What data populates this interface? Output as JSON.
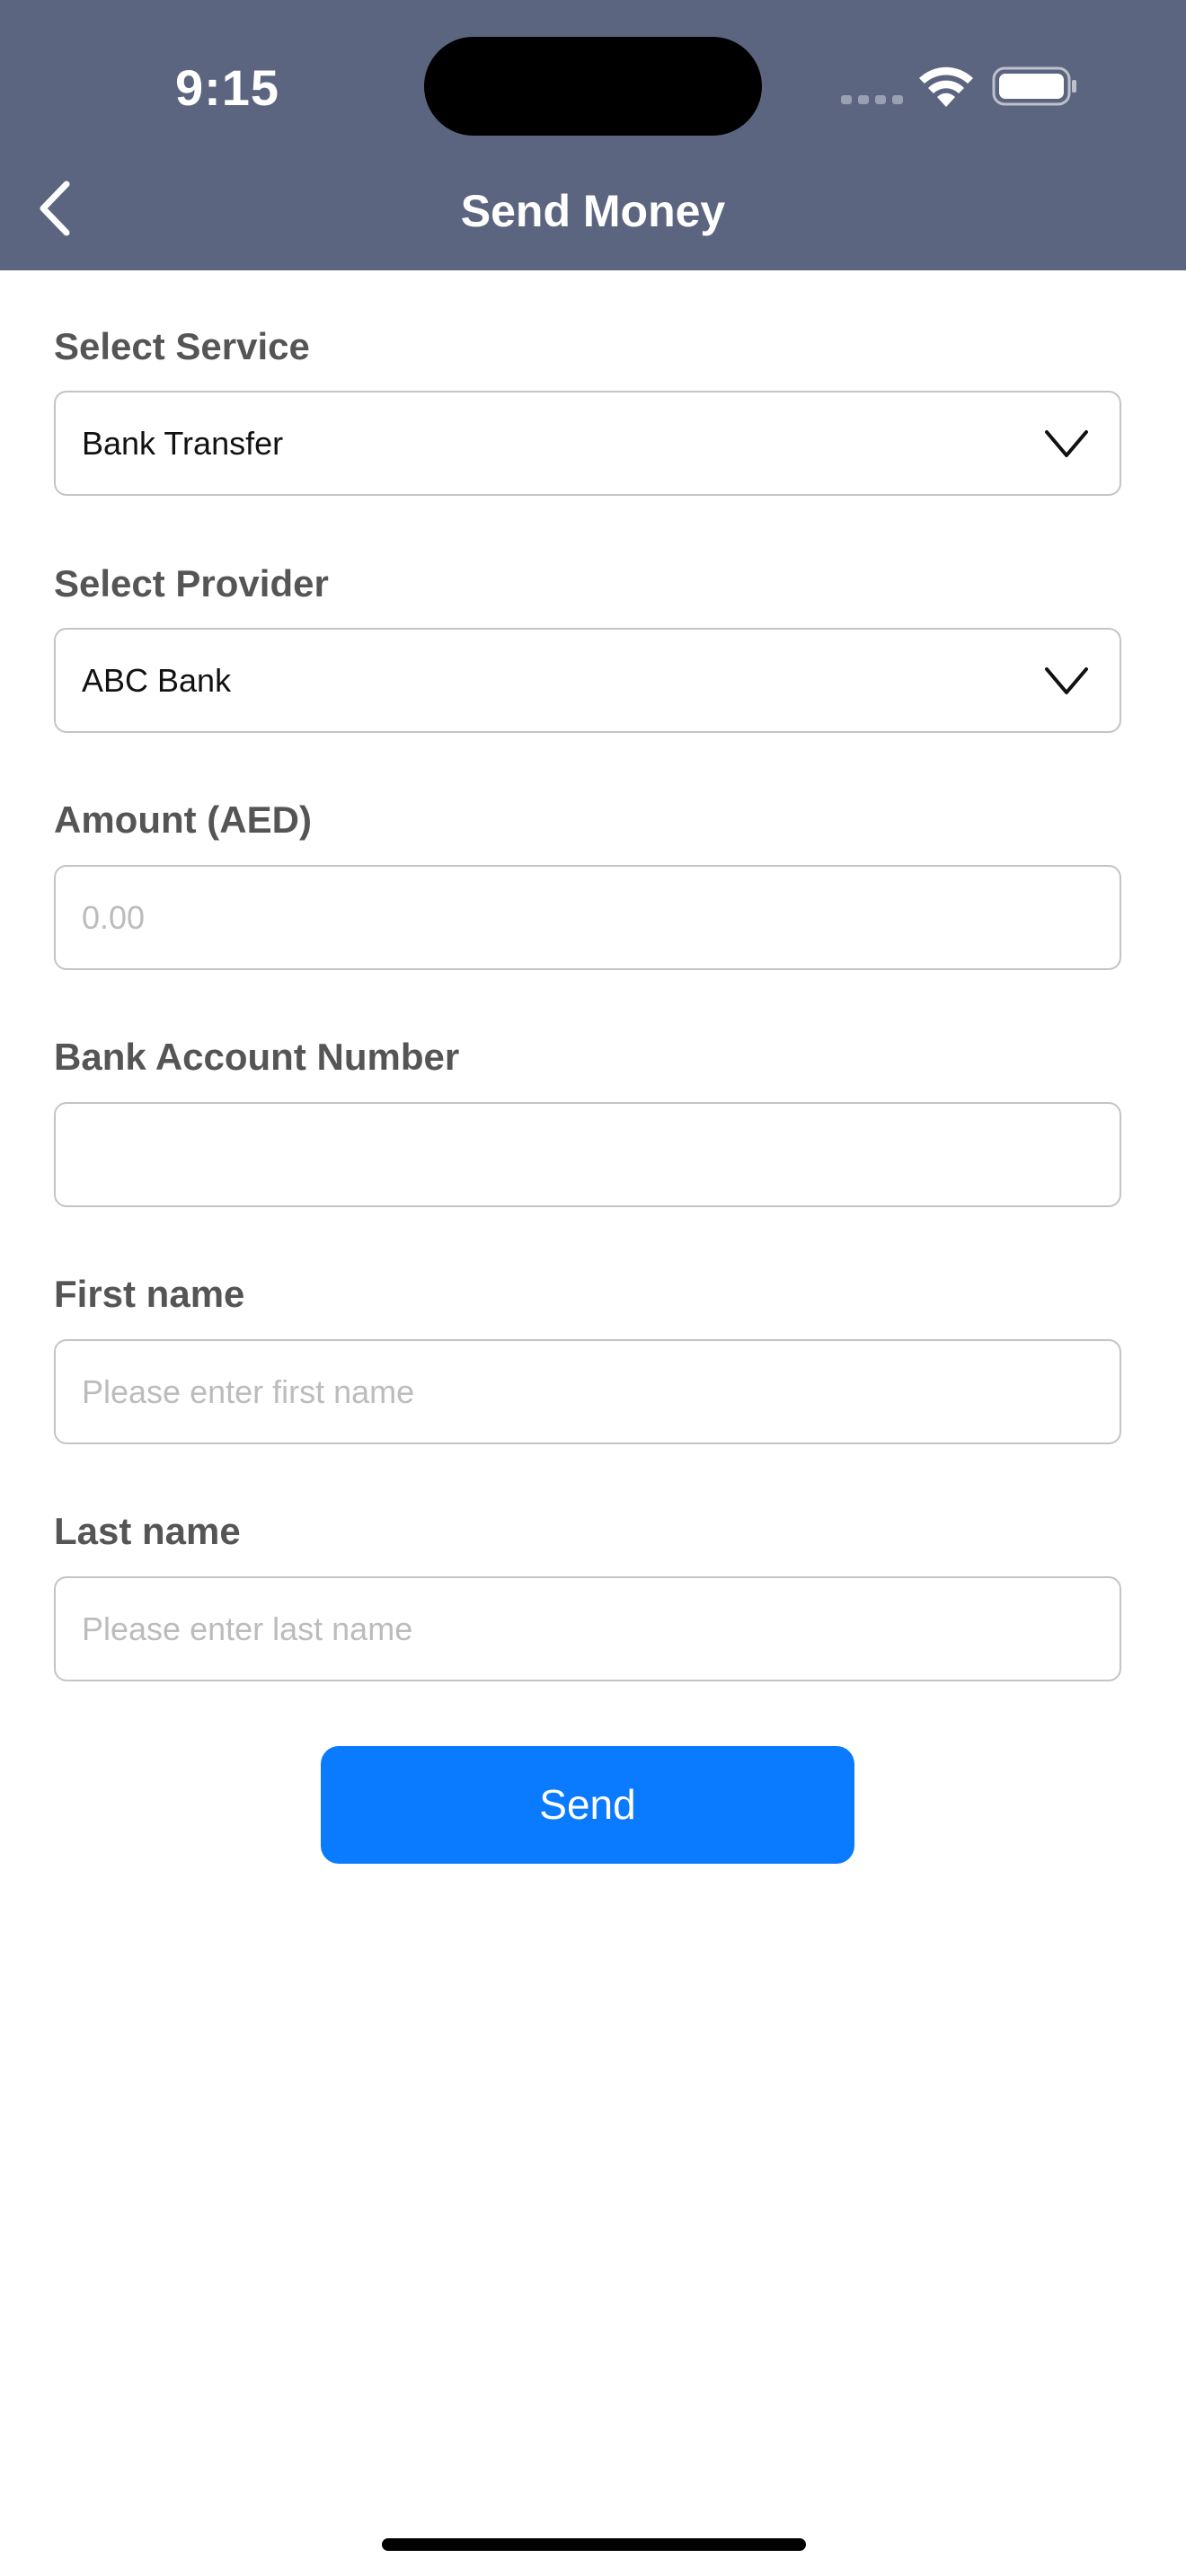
{
  "status_bar": {
    "time": "9:15"
  },
  "nav": {
    "title": "Send Money",
    "back_icon": "chevron-left-icon"
  },
  "form": {
    "service": {
      "label": "Select Service",
      "value": "Bank Transfer",
      "icon": "chevron-down-icon"
    },
    "provider": {
      "label": "Select Provider",
      "value": "ABC Bank",
      "icon": "chevron-down-icon"
    },
    "amount": {
      "label": "Amount (AED)",
      "value": "",
      "placeholder": "0.00"
    },
    "account_number": {
      "label": "Bank Account Number",
      "value": "",
      "placeholder": ""
    },
    "first_name": {
      "label": "First name",
      "value": "",
      "placeholder": "Please enter first name"
    },
    "last_name": {
      "label": "Last name",
      "value": "",
      "placeholder": "Please enter last name"
    },
    "send_label": "Send"
  },
  "colors": {
    "header_bg": "#5c6580",
    "accent": "#0a7aff",
    "label_text": "#555555",
    "border": "#c4c4c4",
    "placeholder": "#bcbcbc"
  }
}
